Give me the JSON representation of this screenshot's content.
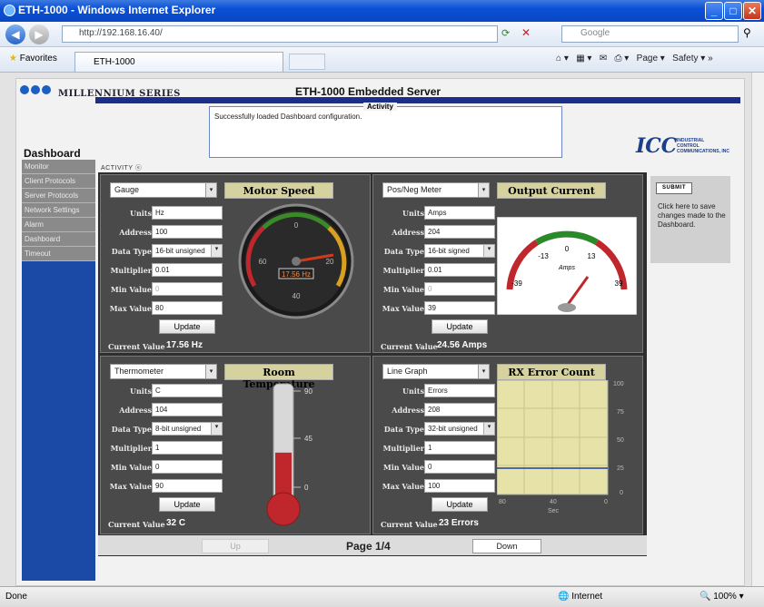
{
  "window": {
    "title": "ETH-1000 - Windows Internet Explorer",
    "minimize": "_",
    "maximize": "□",
    "close": "✕"
  },
  "browser": {
    "url": "http://192.168.16.40/",
    "search_placeholder": "Google",
    "favorites": "Favorites",
    "tab_title": "ETH-1000",
    "tools": [
      "Page ▾",
      "Safety ▾"
    ],
    "status": "Done",
    "zone": "Internet",
    "zoom": "100%"
  },
  "header": {
    "logo_text": "MILLENNIUM SERIES",
    "title": "ETH-1000 Embedded Server",
    "activity_title": "Activity",
    "activity_message": "Successfully loaded Dashboard configuration.",
    "company_logo": "ICC",
    "company_sub": [
      "INDUSTRIAL",
      "CONTROL",
      "COMMUNICATIONS, INC"
    ]
  },
  "sidebar": {
    "title": "Dashboard",
    "items": [
      {
        "label": "Monitor"
      },
      {
        "label": "Client Protocols"
      },
      {
        "label": "Server Protocols"
      },
      {
        "label": "Network Settings"
      },
      {
        "label": "Alarm"
      },
      {
        "label": "Dashboard"
      },
      {
        "label": "Timeout"
      }
    ]
  },
  "activity_label": "ACTIVITY ⓔ",
  "field_labels": {
    "units": "Units",
    "address": "Address",
    "data_type": "Data Type",
    "multiplier": "Multiplier",
    "min_value": "Min Value",
    "max_value": "Max Value",
    "update": "Update",
    "current_value": "Current Value"
  },
  "panels": [
    {
      "type": "Gauge",
      "title": "Motor Speed",
      "units": "Hz",
      "address": "100",
      "data_type": "16-bit unsigned",
      "multiplier": "0.01",
      "min_value": "0",
      "max_value": "80",
      "current": "17.56 Hz",
      "gauge_readout": "17.56 Hz",
      "gauge_ticks": [
        "0",
        "20",
        "40",
        "60"
      ]
    },
    {
      "type": "Pos/Neg Meter",
      "title": "Output Current",
      "units": "Amps",
      "address": "204",
      "data_type": "16-bit signed",
      "multiplier": "0.01",
      "min_value": "0",
      "max_value": "39",
      "current": "24.56 Amps",
      "meter_ticks": [
        "-39",
        "-13",
        "0",
        "13",
        "39"
      ],
      "meter_unit": "Amps"
    },
    {
      "type": "Thermometer",
      "title": "Room Temperature",
      "units": "C",
      "address": "104",
      "data_type": "8-bit unsigned",
      "multiplier": "1",
      "min_value": "0",
      "max_value": "90",
      "current": "32 C",
      "therm_ticks": [
        "90",
        "45",
        "0"
      ],
      "level": 0.36
    },
    {
      "type": "Line Graph",
      "title": "RX Error Count",
      "units": "Errors",
      "address": "208",
      "data_type": "32-bit unsigned",
      "multiplier": "1",
      "min_value": "0",
      "max_value": "100",
      "current": "23 Errors",
      "y_ticks": [
        "100",
        "75",
        "50",
        "25",
        "0"
      ],
      "x_ticks": [
        "80",
        "40",
        "0"
      ],
      "x_label": "Sec"
    }
  ],
  "pager": {
    "up": "Up",
    "page": "Page 1/4",
    "down": "Down"
  },
  "submit": {
    "button": "SUBMIT",
    "help": "Click here to save changes made to the Dashboard."
  }
}
